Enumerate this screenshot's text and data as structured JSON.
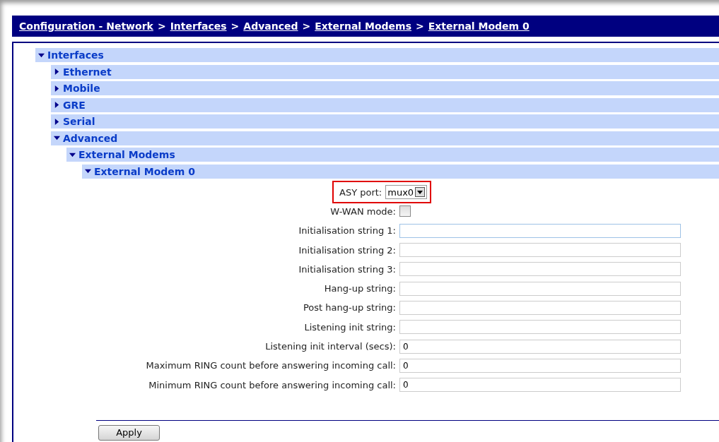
{
  "breadcrumb": [
    {
      "label": "Configuration - Network"
    },
    {
      "label": "Interfaces"
    },
    {
      "label": "Advanced"
    },
    {
      "label": "External Modems"
    },
    {
      "label": "External Modem 0"
    }
  ],
  "breadcrumb_separator": ">",
  "tree": [
    {
      "label": "Interfaces",
      "expanded": true,
      "children": [
        {
          "label": "Ethernet",
          "expanded": false
        },
        {
          "label": "Mobile",
          "expanded": false
        },
        {
          "label": "GRE",
          "expanded": false
        },
        {
          "label": "Serial",
          "expanded": false
        },
        {
          "label": "Advanced",
          "expanded": true,
          "children": [
            {
              "label": "External Modems",
              "expanded": true,
              "children": [
                {
                  "label": "External Modem 0",
                  "expanded": true
                }
              ]
            }
          ]
        }
      ]
    }
  ],
  "fields": [
    {
      "kind": "select",
      "label": "ASY port:",
      "value": "mux0",
      "highlighted": true
    },
    {
      "kind": "checkbox",
      "label": "W-WAN mode:",
      "checked": false,
      "highlighted": false
    },
    {
      "kind": "text",
      "label": "Initialisation string 1:",
      "focused": true,
      "highlighted": false
    },
    {
      "kind": "text",
      "label": "Initialisation string 2:",
      "focused": false,
      "highlighted": false
    },
    {
      "kind": "text",
      "label": "Initialisation string 3:",
      "focused": false,
      "highlighted": false
    },
    {
      "kind": "text",
      "label": "Hang-up string:",
      "focused": false,
      "highlighted": false
    },
    {
      "kind": "text",
      "label": "Post hang-up string:",
      "focused": false,
      "highlighted": false
    },
    {
      "kind": "text",
      "label": "Listening init string:",
      "focused": false,
      "highlighted": false
    },
    {
      "kind": "text",
      "label": "Listening init interval (secs):",
      "value": "0",
      "focused": false,
      "highlighted": false
    },
    {
      "kind": "text",
      "label": "Maximum RING count before answering incoming call:",
      "value": "0",
      "focused": false,
      "highlighted": false
    },
    {
      "kind": "text",
      "label": "Minimum RING count before answering incoming call:",
      "value": "0",
      "focused": false,
      "highlighted": false
    }
  ],
  "apply_button": {
    "label": "Apply"
  }
}
